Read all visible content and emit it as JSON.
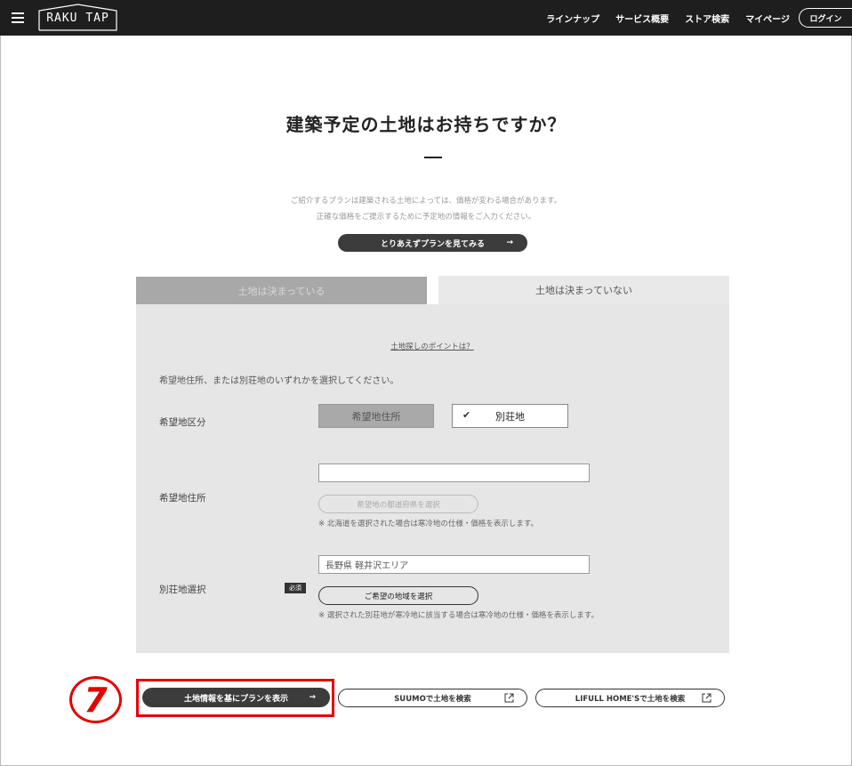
{
  "header": {
    "logo_text": "RAKU TAP",
    "nav": [
      "ラインナップ",
      "サービス概要",
      "ストア検索",
      "マイページ"
    ],
    "login_label": "ログイン"
  },
  "title": "建築予定の土地はお持ちですか？",
  "intro": [
    "ご紹介するプランは建築される土地によっては、価格が変わる場合があります。",
    "正確な価格をご提示するために予定地の情報をご入力ください。"
  ],
  "see_plans_label": "とりあえずプランを見てみる",
  "arrow": "→",
  "tabs": {
    "decided": "土地は決まっている",
    "undecided": "土地は決まっていない"
  },
  "panel": {
    "tips_link": "土地探しのポイントは？",
    "instruction": "希望地住所、または別荘地のいずれかを選択してください。",
    "category_label": "希望地区分",
    "option_address": "希望地住所",
    "option_villa": "別荘地",
    "check_mark": "✔",
    "address_label": "希望地住所",
    "address_value": "",
    "prefecture_button": "希望地の都道府県を選択",
    "address_note": "※ 北海道を選択された場合は寒冷地の仕様・価格を表示します。",
    "villa_label": "別荘地選択",
    "required_badge": "必須",
    "villa_value": "長野県 軽井沢エリア",
    "region_button": "ご希望の地域を選択",
    "villa_note": "※ 選択された別荘地が寒冷地に該当する場合は寒冷地の仕様・価格を表示します。"
  },
  "bottom": {
    "show_plan_label": "土地情報を基にプランを表示",
    "suumo_label": "SUUMOで土地を検索",
    "homes_label": "LIFULL HOME'Sで土地を検索",
    "step_number": "7"
  },
  "colors": {
    "header_bg": "#1e1e1e",
    "accent_red": "#e60000",
    "panel_bg": "#e6e6e6"
  }
}
